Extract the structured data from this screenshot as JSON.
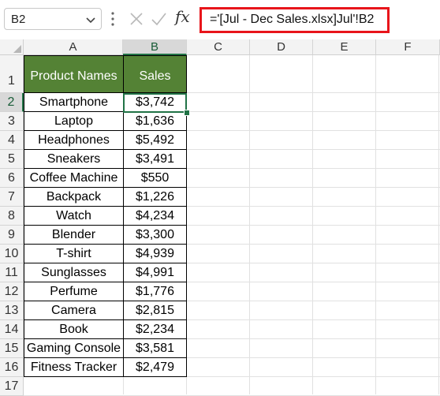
{
  "formula_bar": {
    "name_box": "B2",
    "fx_label": "fx",
    "formula": "='[Jul - Dec Sales.xlsx]Jul'!B2"
  },
  "columns": [
    "A",
    "B",
    "C",
    "D",
    "E",
    "F"
  ],
  "rows": [
    "1",
    "2",
    "3",
    "4",
    "5",
    "6",
    "7",
    "8",
    "9",
    "10",
    "11",
    "12",
    "13",
    "14",
    "15",
    "16",
    "17"
  ],
  "table": {
    "headers": [
      "Product Names",
      "Sales"
    ],
    "header_color": "#548235",
    "data": [
      [
        "Smartphone",
        "$3,742"
      ],
      [
        "Laptop",
        "$1,636"
      ],
      [
        "Headphones",
        "$5,492"
      ],
      [
        "Sneakers",
        "$3,491"
      ],
      [
        "Coffee Machine",
        "$550"
      ],
      [
        "Backpack",
        "$1,226"
      ],
      [
        "Watch",
        "$4,234"
      ],
      [
        "Blender",
        "$3,300"
      ],
      [
        "T-shirt",
        "$4,939"
      ],
      [
        "Sunglasses",
        "$4,991"
      ],
      [
        "Perfume",
        "$1,776"
      ],
      [
        "Camera",
        "$2,815"
      ],
      [
        "Book",
        "$2,234"
      ],
      [
        "Gaming Console",
        "$3,581"
      ],
      [
        "Fitness Tracker",
        "$2,479"
      ]
    ]
  },
  "selection": {
    "active_cell": "B2",
    "accent_color": "#217346",
    "formula_highlight_color": "#e8151b"
  }
}
